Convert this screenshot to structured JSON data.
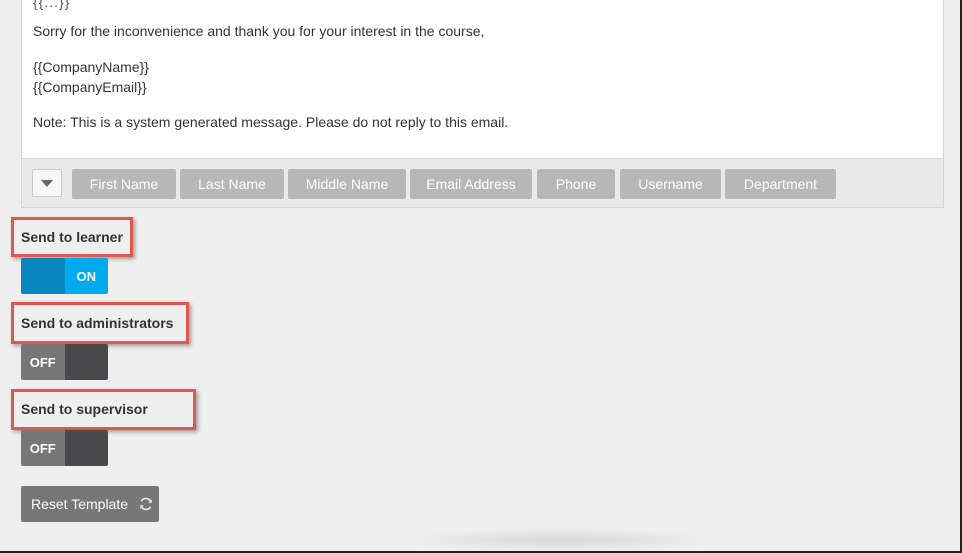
{
  "email_body": {
    "clipped_top": "{{...}}",
    "line1": "Sorry for the inconvenience and thank you for your interest in the course,",
    "company_name": "{{CompanyName}}",
    "company_email": "{{CompanyEmail}}",
    "note": "Note: This is a system generated message. Please do not reply to this email."
  },
  "placeholders": [
    "First Name",
    "Last Name",
    "Middle Name",
    "Email Address",
    "Phone",
    "Username",
    "Department"
  ],
  "toggles": {
    "learner": {
      "label": "Send to learner",
      "state": "ON"
    },
    "administrators": {
      "label": "Send to administrators",
      "state": "OFF"
    },
    "supervisor": {
      "label": "Send to supervisor",
      "state": "OFF"
    }
  },
  "reset_button": {
    "label": "Reset Template",
    "icon": "refresh-icon"
  },
  "colors": {
    "toggle_on_dark": "#0a86bf",
    "toggle_on_light": "#00aaee",
    "toggle_off_label": "#777777",
    "toggle_off_dark": "#4a4a4c",
    "highlight_box": "#e0584c",
    "tag_bg": "#b7b7b7"
  }
}
